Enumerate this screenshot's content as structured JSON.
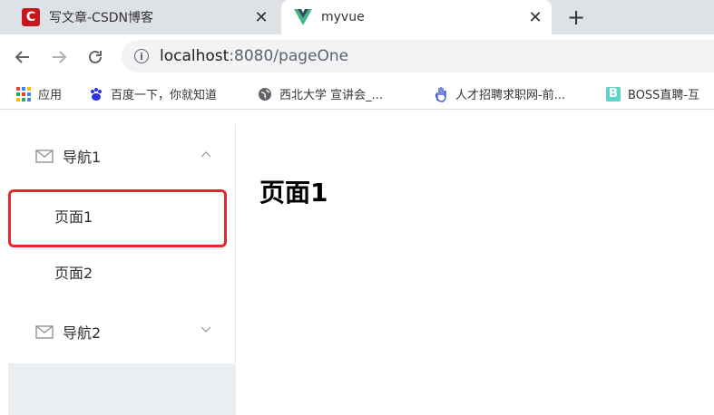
{
  "browser": {
    "tabs": [
      {
        "title": "写文章-CSDN博客",
        "favicon": "csdn-icon",
        "active": false
      },
      {
        "title": "myvue",
        "favicon": "vue-icon",
        "active": true
      }
    ],
    "close_glyph": "✕",
    "new_tab_glyph": "+",
    "url_host": "localhost",
    "url_rest": ":8080/pageOne",
    "bookmarks": [
      {
        "label": "应用",
        "icon": "apps-grid-icon"
      },
      {
        "label": "百度一下，你就知道",
        "icon": "baidu-paw-icon"
      },
      {
        "label": "西北大学 宣讲会_...",
        "icon": "globe-icon"
      },
      {
        "label": "人才招聘求职网-前...",
        "icon": "hand-icon"
      },
      {
        "label": "BOSS直聘-互",
        "icon": "boss-icon"
      }
    ]
  },
  "sidebar": {
    "groups": [
      {
        "title": "导航1",
        "icon": "mail-icon",
        "expanded": true,
        "items": [
          "页面1",
          "页面2"
        ]
      },
      {
        "title": "导航2",
        "icon": "mail-icon",
        "expanded": false,
        "items": []
      }
    ],
    "selected_item": "页面1"
  },
  "main": {
    "heading": "页面1"
  },
  "colors": {
    "tabstrip": "#dee1e6",
    "highlight_border": "#e8262a",
    "aside_bg": "#eaedf1",
    "csdn_red": "#c8161e",
    "vue_green": "#41b883",
    "vue_dark": "#35495e"
  }
}
